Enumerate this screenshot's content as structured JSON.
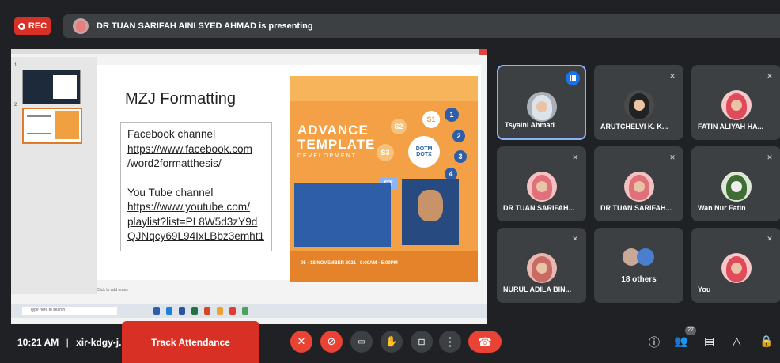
{
  "top": {
    "rec_label": "REC",
    "presenting_text": "DR TUAN SARIFAH AINI SYED AHMAD is presenting"
  },
  "slide": {
    "thumb_numbers": [
      "1",
      "2"
    ],
    "title": "MZJ Formatting",
    "fb_label": "Facebook channel",
    "fb_link_1": "https://www.facebook.com",
    "fb_link_2": "/word2formatthesis/",
    "yt_label": "You Tube channel",
    "yt_link_1": "https://www.youtube.com/",
    "yt_link_2": "playlist?list=PL8W5d3zY9d",
    "yt_link_3": "QJNqcy69L94IxLBbz3emht1",
    "notes_placeholder": "Click to add notes",
    "poster_title_1": "ADVANCE",
    "poster_title_2": "TEMPLATE",
    "poster_subtitle": "DEVELOPMENT",
    "poster_badges": [
      "S1",
      "S2",
      "S3",
      "DOTM",
      "DOTX",
      "FT",
      "XT",
      "1",
      "2",
      "3",
      "4"
    ],
    "poster_date": "05 - 18 NOVEMBER 2021 | 9:00AM - 5:00PM",
    "taskbar_search": "Type here to search"
  },
  "participants": [
    {
      "name": "Tsyaini Ahmad",
      "speaking": true
    },
    {
      "name": "ARUTCHELVI K. K...",
      "muted": true
    },
    {
      "name": "FATIN ALIYAH HA...",
      "muted": true
    },
    {
      "name": "DR TUAN SARIFAH...",
      "muted": true
    },
    {
      "name": "DR TUAN SARIFAH...",
      "muted": true
    },
    {
      "name": "Wan Nur Fatin",
      "muted": true
    },
    {
      "name": "NURUL ADILA BIN...",
      "muted": true
    },
    {
      "name": "18 others"
    },
    {
      "name": "You",
      "muted": true
    }
  ],
  "bottom": {
    "time": "10:21 AM",
    "separator": "|",
    "meeting_code": "xir-kdgy-j...",
    "track_attendance": "Track Attendance",
    "people_count": "27"
  },
  "icons": [
    "mic-off-icon",
    "camera-off-icon",
    "captions-icon",
    "raise-hand-icon",
    "present-icon",
    "more-options-icon",
    "end-call-icon",
    "info-icon",
    "people-icon",
    "chat-icon",
    "activities-icon",
    "host-controls-icon"
  ],
  "colors": {
    "rec_red": "#d93025",
    "active_tile_border": "#8ab4f8",
    "background": "#202124",
    "tile": "#3c4043"
  }
}
